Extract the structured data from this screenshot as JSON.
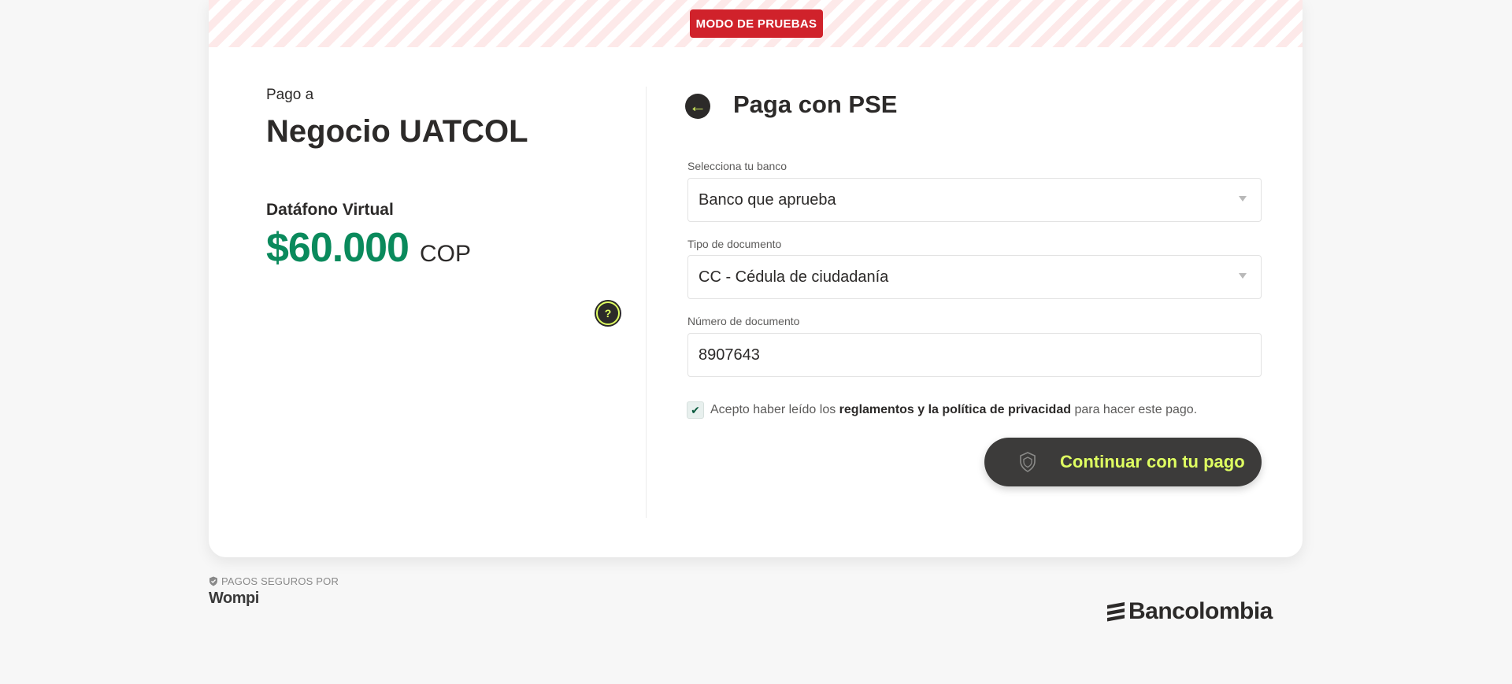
{
  "banner": {
    "label": "MODO DE PRUEBAS"
  },
  "summary": {
    "pay_to_label": "Pago a",
    "merchant_name": "Negocio UATCOL",
    "product_name": "Datáfono Virtual",
    "amount": "$60.000",
    "currency": "COP",
    "help_icon": "question-icon"
  },
  "form": {
    "title": "Paga con PSE",
    "back_icon": "arrow-left-icon",
    "bank": {
      "label": "Selecciona tu banco",
      "value": "Banco que aprueba"
    },
    "doc_type": {
      "label": "Tipo de documento",
      "value": "CC - Cédula de ciudadanía"
    },
    "doc_number": {
      "label": "Número de documento",
      "value": "8907643"
    },
    "terms": {
      "checked": true,
      "prefix": "Acepto haber leído los",
      "link": "reglamentos y la política de privacidad",
      "suffix": "para hacer este pago."
    },
    "submit_label": "Continuar con tu pago"
  },
  "footer": {
    "secure_label": "PAGOS SEGUROS POR",
    "wompi": "Wompi",
    "bancolombia": "Bancolombia"
  },
  "colors": {
    "accent_green": "#0a8a5c",
    "accent_lime": "#dfff61",
    "badge_red": "#d0222b",
    "dark": "#2c2a29"
  }
}
